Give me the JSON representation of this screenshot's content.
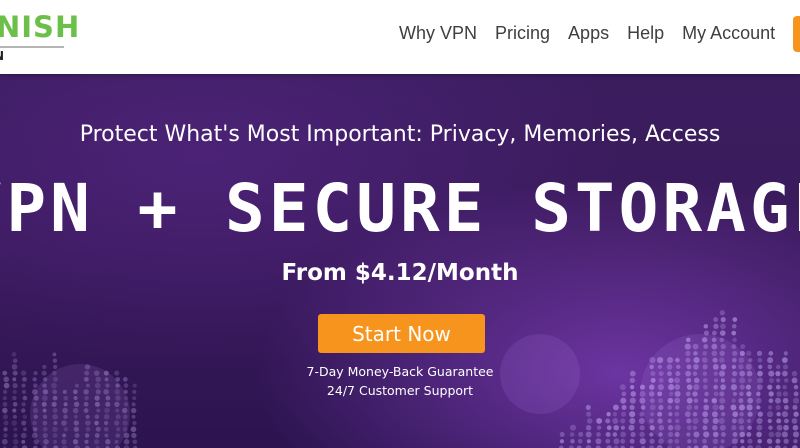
{
  "header": {
    "logo_text": "NISH",
    "logo_subtext": "N",
    "nav": [
      {
        "label": "Why VPN"
      },
      {
        "label": "Pricing"
      },
      {
        "label": "Apps"
      },
      {
        "label": "Help"
      },
      {
        "label": "My Account"
      }
    ]
  },
  "hero": {
    "tagline": "Protect What's Most Important: Privacy, Memories, Access",
    "headline": "VPN + SECURE STORAGE",
    "price": "From $4.12/Month",
    "cta_label": "Start Now",
    "guarantee": "7-Day Money-Back Guarantee",
    "support": "24/7 Customer Support"
  },
  "colors": {
    "brand_green": "#6cc04a",
    "accent_orange": "#f7941d",
    "hero_purple": "#3a1a5c",
    "nav_text": "#3f3f3f"
  }
}
